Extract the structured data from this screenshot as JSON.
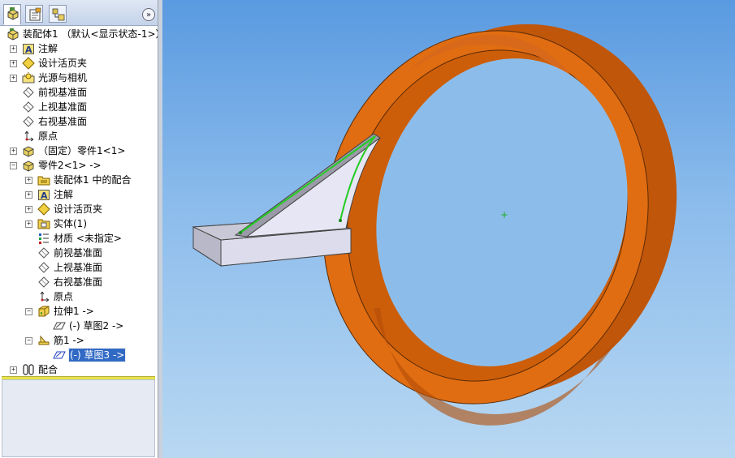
{
  "window": {
    "kind": "SolidWorks FeatureManager design tree with 3D graphics area"
  },
  "tabs": [
    {
      "name": "featuremanager-tab",
      "icon": "featuremanager-icon",
      "active": true
    },
    {
      "name": "propertymanager-tab",
      "icon": "propertymanager-icon",
      "active": false
    },
    {
      "name": "configurationmanager-tab",
      "icon": "configurationmanager-icon",
      "active": false
    }
  ],
  "collapse_label": "»",
  "tree": {
    "root": "装配体1  （默认<显示状态-1>）",
    "items": [
      {
        "label": "注解"
      },
      {
        "label": "设计活页夹"
      },
      {
        "label": "光源与相机"
      },
      {
        "label": "前视基准面"
      },
      {
        "label": "上视基准面"
      },
      {
        "label": "右视基准面"
      },
      {
        "label": "原点"
      },
      {
        "label": "（固定）零件1<1>"
      },
      {
        "label": "零件2<1> ->"
      },
      {
        "label": "装配体1 中的配合"
      },
      {
        "label": "注解"
      },
      {
        "label": "设计活页夹"
      },
      {
        "label": "实体(1)"
      },
      {
        "label": "材质 <未指定>"
      },
      {
        "label": "前视基准面"
      },
      {
        "label": "上视基准面"
      },
      {
        "label": "右视基准面"
      },
      {
        "label": "原点"
      },
      {
        "label": "拉伸1 ->"
      },
      {
        "label": "(-) 草图2 ->"
      },
      {
        "label": "筋1 ->"
      },
      {
        "label": "(-) 草图3 ->"
      },
      {
        "label": "配合"
      }
    ]
  },
  "colors": {
    "ring_front": "#e06d12",
    "ring_inner": "#cc5e0a",
    "ring_dark": "#b04c06",
    "rib_face": "#ececf4",
    "sketch_line": "#22cc22",
    "selection": "#316ac5"
  },
  "viewport": {
    "origin_marker": "+"
  }
}
